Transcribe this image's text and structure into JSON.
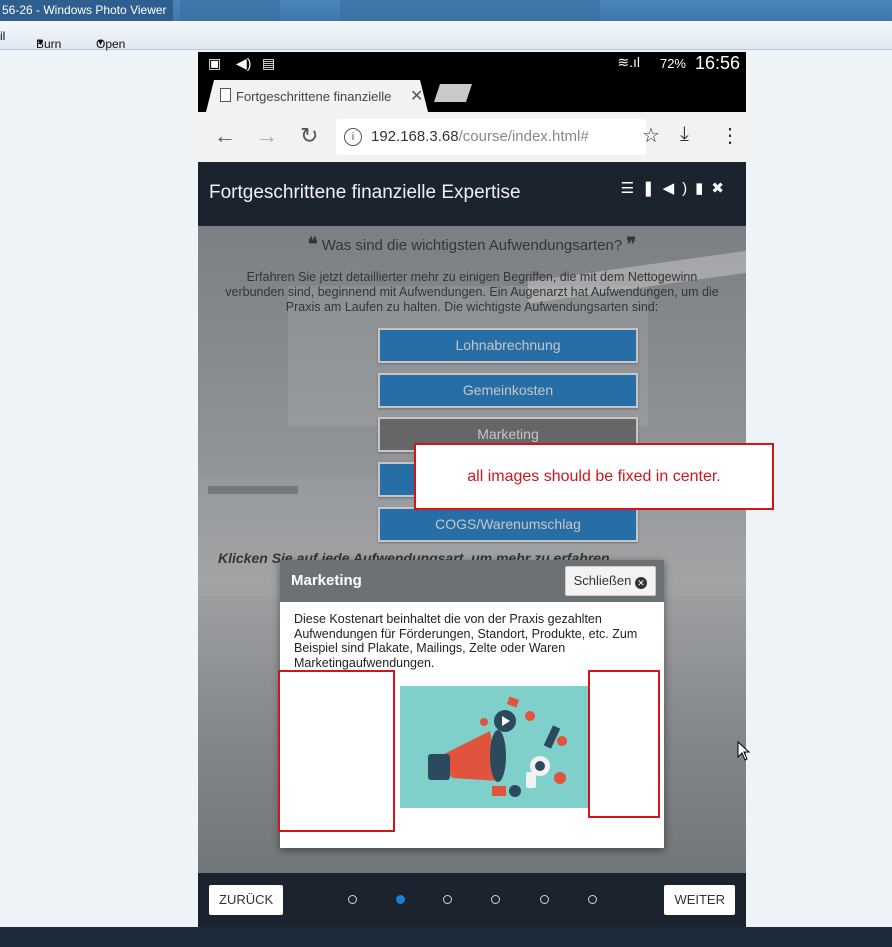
{
  "window": {
    "title": "56-26 - Windows Photo Viewer"
  },
  "menu": {
    "items": [
      "il",
      "Burn",
      "Open"
    ]
  },
  "status": {
    "battery": "72%",
    "time": "16:56"
  },
  "browser": {
    "tab_title": "Fortgeschrittene finanzielle",
    "url_host": "192.168.3.68",
    "url_path": "/course/index.html#"
  },
  "app": {
    "title": "Fortgeschrittene finanzielle Expertise",
    "question": "Was sind die wichtigsten Aufwendungsarten?",
    "intro": "Erfahren Sie jetzt detaillierter mehr zu einigen Begriffen, die mit dem Nettogewinn verbunden sind, beginnend mit Aufwendungen. Ein Augenarzt hat Aufwendungen, um die Praxis am Laufen zu halten. Die wichtigste Aufwendungsarten sind:",
    "buttons": [
      "Lohnabrechnung",
      "Gemeinkosten",
      "Marketing",
      "",
      "COGS/Warenumschlag"
    ],
    "hint": "Klicken Sie auf jede Aufwendungsart, um mehr zu erfahren",
    "modal": {
      "title": "Marketing",
      "close": "Schließen",
      "body": "Diese Kostenart beinhaltet die von der Praxis gezahlten Aufwendungen für Förderungen, Standort, Produkte, etc. Zum Beispiel sind Plakate, Mailings, Zelte oder Waren Marketingaufwendungen."
    },
    "footer": {
      "back": "ZURÜCK",
      "next": "WEITER",
      "page_count": 6,
      "active_page": 2
    }
  },
  "annotation": {
    "text": "all images should be fixed in center."
  },
  "colors": {
    "accent": "#0e7ad0",
    "header": "#1b242e",
    "annotation": "#d0161b"
  }
}
